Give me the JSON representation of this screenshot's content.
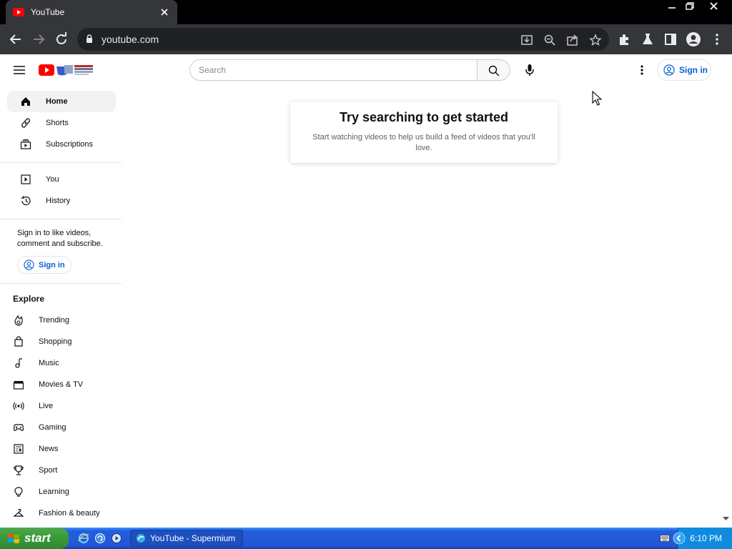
{
  "browser": {
    "tab_title": "YouTube",
    "url": "youtube.com"
  },
  "header": {
    "search_placeholder": "Search",
    "signin_label": "Sign in"
  },
  "sidebar": {
    "main": [
      {
        "label": "Home",
        "icon": "home-icon"
      },
      {
        "label": "Shorts",
        "icon": "shorts-icon"
      },
      {
        "label": "Subscriptions",
        "icon": "subscriptions-icon"
      }
    ],
    "you": [
      {
        "label": "You",
        "icon": "you-icon"
      },
      {
        "label": "History",
        "icon": "history-icon"
      }
    ],
    "signin_prompt": "Sign in to like videos, comment and subscribe.",
    "signin_label": "Sign in",
    "explore_title": "Explore",
    "explore": [
      {
        "label": "Trending",
        "icon": "trending-icon"
      },
      {
        "label": "Shopping",
        "icon": "shopping-icon"
      },
      {
        "label": "Music",
        "icon": "music-icon"
      },
      {
        "label": "Movies & TV",
        "icon": "movies-icon"
      },
      {
        "label": "Live",
        "icon": "live-icon"
      },
      {
        "label": "Gaming",
        "icon": "gaming-icon"
      },
      {
        "label": "News",
        "icon": "news-icon"
      },
      {
        "label": "Sport",
        "icon": "sport-icon"
      },
      {
        "label": "Learning",
        "icon": "learning-icon"
      },
      {
        "label": "Fashion & beauty",
        "icon": "fashion-icon"
      }
    ]
  },
  "main": {
    "empty_title": "Try searching to get started",
    "empty_desc": "Start watching videos to help us build a feed of videos that you'll love."
  },
  "taskbar": {
    "start_label": "start",
    "task_item": "YouTube - Supermium",
    "clock": "6:10 PM"
  },
  "colors": {
    "accent": "#065fd4",
    "youtube_red": "#ff0000",
    "chrome_dark": "#35363a"
  }
}
